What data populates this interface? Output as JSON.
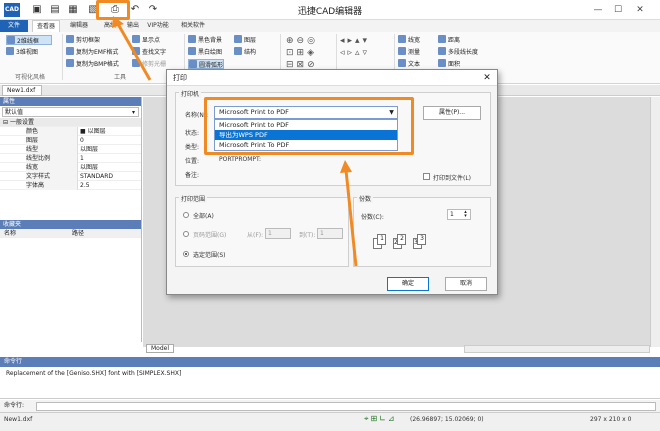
{
  "window": {
    "title": "迅捷CAD编辑器",
    "logo": "CAD"
  },
  "quick_access": [
    "new-icon",
    "open-icon",
    "save-icon",
    "saveas-icon",
    "print-icon",
    "undo-icon",
    "redo-icon"
  ],
  "ribbon_tabs": [
    "文件",
    "查看器",
    "编辑器",
    "高级",
    "输出",
    "VIP功能",
    "相关软件"
  ],
  "ribbon": {
    "view_group": {
      "label": "可视化风格",
      "items": [
        "2维线框",
        "3维视图"
      ]
    },
    "tools_group": {
      "label": "工具",
      "items": [
        "剪切框架",
        "复制为EMF格式",
        "复制为BMP格式",
        "显示点",
        "查找文字",
        "修剪光栅"
      ]
    },
    "display_items": [
      "黑色背景",
      "黑白绘图",
      "圆滑弧形",
      "图层",
      "结构"
    ],
    "measure_items": [
      "线宽",
      "测量",
      "文本",
      "距离",
      "多段线长度",
      "面积"
    ]
  },
  "document": {
    "tab": "New1.dxf",
    "model_tab": "Model"
  },
  "properties": {
    "header": "属性",
    "selector": "默认值",
    "section": "一般设置",
    "rows": [
      {
        "name": "颜色",
        "value": "■ 以图层"
      },
      {
        "name": "图层",
        "value": "0"
      },
      {
        "name": "线型",
        "value": "以图层"
      },
      {
        "name": "线型比例",
        "value": "1"
      },
      {
        "name": "线宽",
        "value": "以图层"
      },
      {
        "name": "文字样式",
        "value": "STANDARD"
      },
      {
        "name": "字体高",
        "value": "2.5"
      }
    ]
  },
  "favorites": {
    "header": "收藏夹",
    "columns": [
      "名称",
      "路径"
    ]
  },
  "command": {
    "header": "命令行",
    "log": "Replacement of the [Geniso.SHX] font with [SIMPLEX.SHX]",
    "prompt": "命令行:"
  },
  "status_bar": {
    "file": "New1.dxf",
    "coords": "(26.96897; 15.02069; 0)",
    "size": "297 x 210 x 0"
  },
  "print_dialog": {
    "title": "打印",
    "printer_group": "打印机",
    "name_label": "名称(N):",
    "name_value": "Microsoft Print to PDF",
    "options": [
      "Microsoft Print to PDF",
      "导出为WPS PDF",
      "Microsoft Print To PDF"
    ],
    "selected_option": 1,
    "status_label": "状态:",
    "type_label": "类型:",
    "where_label": "位置:",
    "where_value": "PORTPROMPT:",
    "comment_label": "备注:",
    "properties_button": "属性(P)...",
    "print_to_file": "打印到文件(L)",
    "range_group": "打印范围",
    "range_all": "全部(A)",
    "range_pages": "页码范围(G)",
    "from_label": "从(F):",
    "from_value": "1",
    "to_label": "到(T):",
    "to_value": "1",
    "range_selection": "选定范围(S)",
    "copies_group": "份数",
    "copies_label": "份数(C):",
    "copies_value": "1",
    "collate_labels": [
      "1",
      "1",
      "2",
      "2",
      "3",
      "3"
    ],
    "ok_button": "确定",
    "cancel_button": "取消"
  },
  "annotation_color": "#f08a24"
}
